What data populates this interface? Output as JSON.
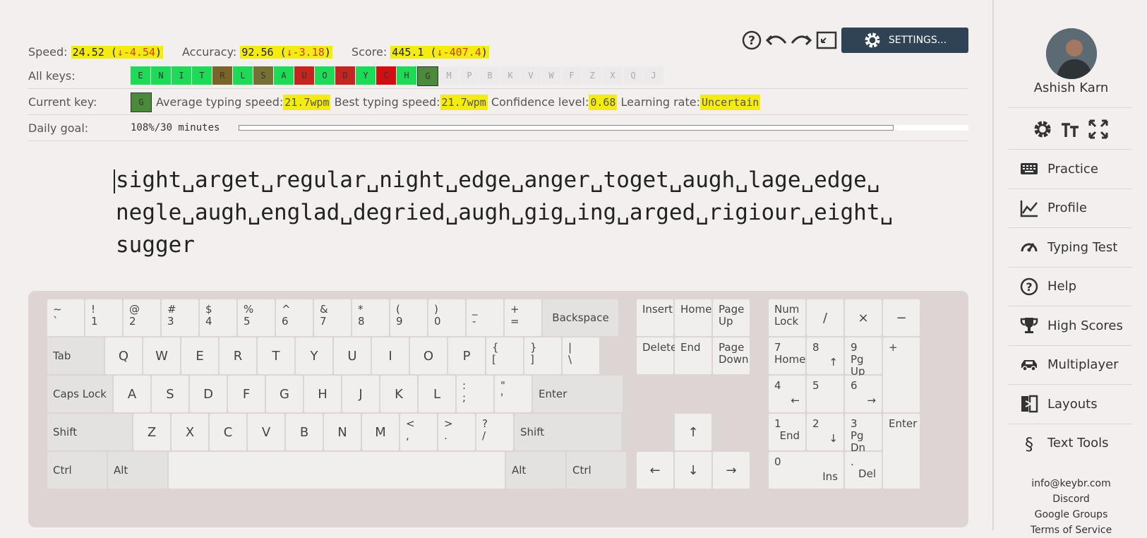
{
  "stats": {
    "speed_label": "Speed:",
    "speed_value": "24.52",
    "speed_delta": "↓-4.54",
    "accuracy_label": "Accuracy:",
    "accuracy_value": "92.56",
    "accuracy_delta": "↓-3.18",
    "score_label": "Score:",
    "score_value": "445.1",
    "score_delta": "↓-407.4",
    "paren_open": "(",
    "paren_close": ")"
  },
  "toolbar": {
    "settings_label": "SETTINGS...",
    "icons": [
      "help-icon",
      "undo-icon",
      "redo-icon",
      "fullscreen-icon",
      "gear-icon"
    ]
  },
  "all_keys": {
    "label": "All keys:",
    "keys": [
      {
        "k": "E",
        "c": "#1ddb56"
      },
      {
        "k": "N",
        "c": "#1ddb56"
      },
      {
        "k": "I",
        "c": "#1ddb56"
      },
      {
        "k": "T",
        "c": "#1ddb56"
      },
      {
        "k": "R",
        "c": "#7a6428"
      },
      {
        "k": "L",
        "c": "#1ddb56"
      },
      {
        "k": "S",
        "c": "#757033"
      },
      {
        "k": "A",
        "c": "#1ddb56"
      },
      {
        "k": "U",
        "c": "#c4261f"
      },
      {
        "k": "O",
        "c": "#1ddb56"
      },
      {
        "k": "D",
        "c": "#c4261f"
      },
      {
        "k": "Y",
        "c": "#1ddb56"
      },
      {
        "k": "C",
        "c": "#d01010"
      },
      {
        "k": "H",
        "c": "#1ddb56"
      },
      {
        "k": "G",
        "c": "#4a8a3a"
      },
      {
        "k": "M",
        "c": "#eceaea"
      },
      {
        "k": "P",
        "c": "#eceaea"
      },
      {
        "k": "B",
        "c": "#eceaea"
      },
      {
        "k": "K",
        "c": "#eceaea"
      },
      {
        "k": "V",
        "c": "#eceaea"
      },
      {
        "k": "W",
        "c": "#eceaea"
      },
      {
        "k": "F",
        "c": "#eceaea"
      },
      {
        "k": "Z",
        "c": "#eceaea"
      },
      {
        "k": "X",
        "c": "#eceaea"
      },
      {
        "k": "Q",
        "c": "#eceaea"
      },
      {
        "k": "J",
        "c": "#eceaea"
      }
    ]
  },
  "current_key": {
    "label": "Current key:",
    "key": "G",
    "avg_label": "Average typing speed:",
    "avg_value": "21.7wpm",
    "best_label": "Best typing speed:",
    "best_value": "21.7wpm",
    "conf_label": "Confidence level:",
    "conf_value": "0.68",
    "rate_label": "Learning rate:",
    "rate_value": "Uncertain"
  },
  "daily_goal": {
    "label": "Daily goal:",
    "value": "108%/30 minutes",
    "progress": 1.0
  },
  "lesson": {
    "lines": [
      "sight␣arget␣regular␣night␣edge␣anger␣toget␣augh␣lage␣edge␣",
      "negle␣augh␣englad␣degried␣augh␣gig␣ing␣arged␣rigiour␣eight␣",
      "sugger"
    ]
  },
  "keyboard": {
    "backspace": "Backspace",
    "tab": "Tab",
    "caps": "Caps Lock",
    "enter": "Enter",
    "shift": "Shift",
    "ctrl": "Ctrl",
    "alt": "Alt",
    "insert": "Insert",
    "home": "Home",
    "page_up": "Page Up",
    "delete": "Delete",
    "end": "End",
    "page_down": "Page Down",
    "num_lock": "Num Lock",
    "num_div": "/",
    "num_mul": "×",
    "num_minus": "−",
    "num_plus": "+",
    "num_enter": "Enter",
    "arrow_up": "↑",
    "arrow_left": "←",
    "arrow_down": "↓",
    "arrow_right": "→",
    "num7": "7",
    "num7b": "Home",
    "num8": "8",
    "num8b": "↑",
    "num9": "9",
    "num9b": "Pg Up",
    "num4": "4",
    "num4b": "←",
    "num5": "5",
    "num6": "6",
    "num6b": "→",
    "num1": "1",
    "num1b": "End",
    "num2": "2",
    "num2b": "↓",
    "num3": "3",
    "num3b": "Pg Dn",
    "num0": "0",
    "num0b": "Ins",
    "numdot": ".",
    "numdotb": "Del",
    "row1": [
      [
        "~",
        "`"
      ],
      [
        "!",
        "1"
      ],
      [
        "@",
        "2"
      ],
      [
        "#",
        "3"
      ],
      [
        "$",
        "4"
      ],
      [
        "%",
        "5"
      ],
      [
        "^",
        "6"
      ],
      [
        "&",
        "7"
      ],
      [
        "*",
        "8"
      ],
      [
        "(",
        "9"
      ],
      [
        ")",
        "0"
      ],
      [
        "_",
        "-"
      ],
      [
        "+",
        "="
      ]
    ],
    "row2": [
      "Q",
      "W",
      "E",
      "R",
      "T",
      "Y",
      "U",
      "I",
      "O",
      "P",
      [
        "{",
        "["
      ],
      [
        "}",
        "]"
      ],
      [
        "|",
        "\\"
      ]
    ],
    "row3": [
      "A",
      "S",
      "D",
      "F",
      "G",
      "H",
      "J",
      "K",
      "L",
      [
        ":",
        ";"
      ],
      [
        "\"",
        "'"
      ]
    ],
    "row4": [
      "Z",
      "X",
      "C",
      "V",
      "B",
      "N",
      "M",
      [
        "<",
        ","
      ],
      [
        ">",
        "."
      ],
      [
        "?",
        "/"
      ]
    ]
  },
  "sidebar": {
    "user_name": "Ashish Karn",
    "tools": [
      "theme-icon",
      "font-size-icon",
      "expand-icon"
    ],
    "items": [
      {
        "label": "Practice",
        "icon": "keyboard-icon"
      },
      {
        "label": "Profile",
        "icon": "chart-icon"
      },
      {
        "label": "Typing Test",
        "icon": "speedometer-icon"
      },
      {
        "label": "Help",
        "icon": "help-icon"
      },
      {
        "label": "High Scores",
        "icon": "trophy-icon"
      },
      {
        "label": "Multiplayer",
        "icon": "car-icon"
      },
      {
        "label": "Layouts",
        "icon": "layouts-icon"
      },
      {
        "label": "Text Tools",
        "icon": "section-icon"
      }
    ],
    "footer": [
      "info@keybr.com",
      "Discord",
      "Google Groups",
      "Terms of Service"
    ]
  }
}
